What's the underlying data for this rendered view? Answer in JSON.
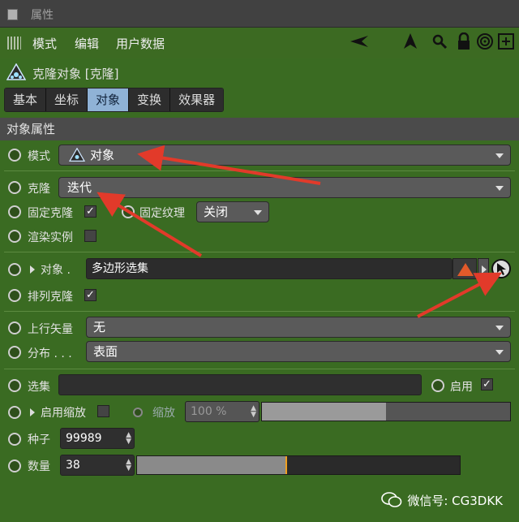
{
  "window": {
    "title": "属性"
  },
  "menubar": {
    "mode": "模式",
    "edit": "编辑",
    "userdata": "用户数据"
  },
  "object_header": {
    "title": "克隆对象 [克隆]"
  },
  "tabs": [
    "基本",
    "坐标",
    "对象",
    "变换",
    "效果器"
  ],
  "active_tab": "对象",
  "section": {
    "title": "对象属性"
  },
  "fields": {
    "mode_label": "模式",
    "mode_value": "对象",
    "clone_label": "克隆",
    "clone_value": "迭代",
    "fixed_clone_label": "固定克隆",
    "fixed_texture_label": "固定纹理",
    "fixed_texture_value": "关闭",
    "render_instance_label": "渲染实例",
    "object_label": "对象 .",
    "object_value": "多边形选集",
    "arrange_clone_label": "排列克隆",
    "up_vector_label": "上行矢量",
    "up_vector_value": "无",
    "distribution_label": "分布 . . .",
    "distribution_value": "表面",
    "selection_label": "选集",
    "enable_label": "启用",
    "enable_scale_label": "启用缩放",
    "scale_label": "缩放",
    "scale_value": "100 %",
    "seed_label": "种子",
    "seed_value": "99989",
    "count_label": "数量",
    "count_value": "38"
  },
  "checkmark": "✓",
  "count_slider": {
    "fill_fraction": 0.46
  },
  "scale_slider": {
    "fill_fraction": 0.5
  },
  "watermark": {
    "text": "微信号: CG3DKK"
  },
  "colors": {
    "panel_bg": "#3a6b22",
    "accent_tab": "#8fb2d6",
    "annotation_arrow": "#e23a2a"
  }
}
